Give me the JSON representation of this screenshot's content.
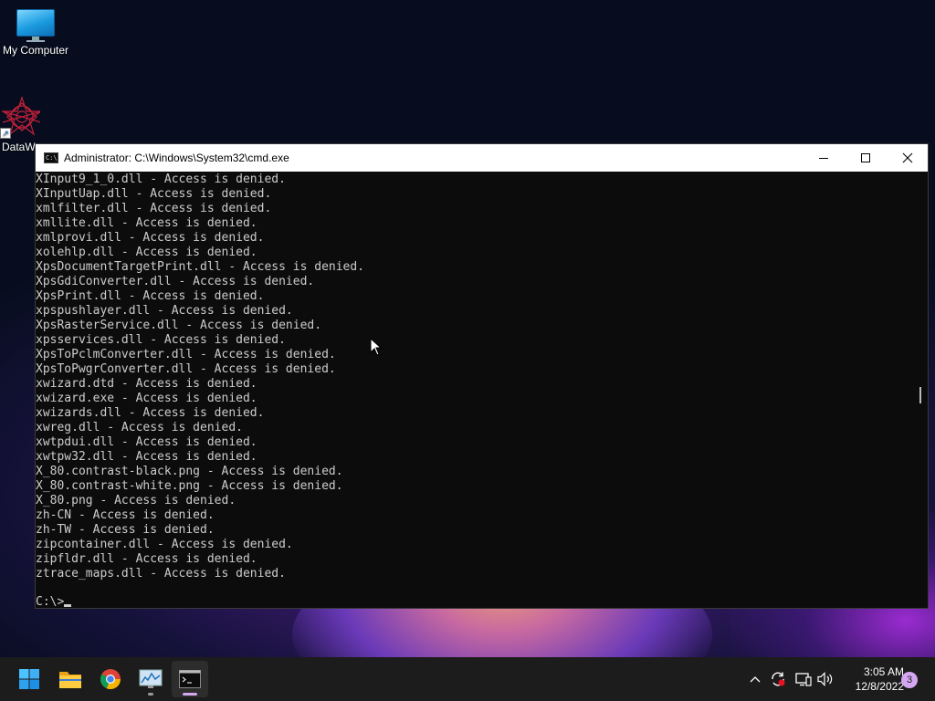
{
  "desktop": {
    "icons": [
      {
        "label": "My Computer",
        "icon": "monitor-icon"
      },
      {
        "label": "DataW",
        "icon": "star-shortcut-icon"
      }
    ]
  },
  "window": {
    "title": "Administrator: C:\\Windows\\System32\\cmd.exe",
    "icon_text": "C:\\",
    "controls": {
      "minimize": "minimize-icon",
      "maximize": "maximize-icon",
      "close": "close-icon"
    }
  },
  "console": {
    "lines": [
      "XInput9_1_0.dll - Access is denied.",
      "XInputUap.dll - Access is denied.",
      "xmlfilter.dll - Access is denied.",
      "xmllite.dll - Access is denied.",
      "xmlprovi.dll - Access is denied.",
      "xolehlp.dll - Access is denied.",
      "XpsDocumentTargetPrint.dll - Access is denied.",
      "XpsGdiConverter.dll - Access is denied.",
      "XpsPrint.dll - Access is denied.",
      "xpspushlayer.dll - Access is denied.",
      "XpsRasterService.dll - Access is denied.",
      "xpsservices.dll - Access is denied.",
      "XpsToPclmConverter.dll - Access is denied.",
      "XpsToPwgrConverter.dll - Access is denied.",
      "xwizard.dtd - Access is denied.",
      "xwizard.exe - Access is denied.",
      "xwizards.dll - Access is denied.",
      "xwreg.dll - Access is denied.",
      "xwtpdui.dll - Access is denied.",
      "xwtpw32.dll - Access is denied.",
      "X_80.contrast-black.png - Access is denied.",
      "X_80.contrast-white.png - Access is denied.",
      "X_80.png - Access is denied.",
      "zh-CN - Access is denied.",
      "zh-TW - Access is denied.",
      "zipcontainer.dll - Access is denied.",
      "zipfldr.dll - Access is denied.",
      "ztrace_maps.dll - Access is denied.",
      ""
    ],
    "prompt": "C:\\>"
  },
  "taskbar": {
    "apps": [
      {
        "name": "start",
        "icon": "windows-start-icon"
      },
      {
        "name": "file-explorer",
        "icon": "folder-icon"
      },
      {
        "name": "chrome",
        "icon": "chrome-icon"
      },
      {
        "name": "resource-monitor",
        "icon": "monitor-chart-icon"
      },
      {
        "name": "cmd",
        "icon": "terminal-icon"
      }
    ],
    "tray": {
      "time": "3:05 AM",
      "date": "12/8/2022",
      "notification_count": "3"
    }
  },
  "colors": {
    "console_bg": "#0c0c0c",
    "console_fg": "#cccccc",
    "taskbar_bg": "#1c1c1c",
    "active_indicator": "#d4a7f0"
  }
}
